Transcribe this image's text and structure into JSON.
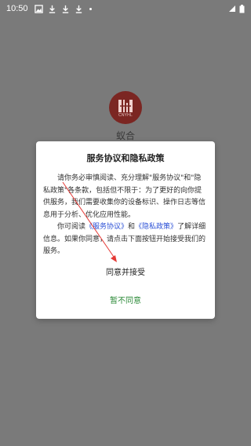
{
  "status_bar": {
    "time": "10:50",
    "icons": [
      "image-icon",
      "download-icon",
      "download-icon",
      "download-icon",
      "dot-icon"
    ],
    "right_icons": [
      "signal-icon",
      "battery-icon"
    ]
  },
  "app": {
    "name": "蚁合",
    "logo_caption": "CNYHL"
  },
  "dialog": {
    "title": "服务协议和隐私政策",
    "para1": "请你务必审慎阅读、充分理解\"服务协议\"和\"隐私政策\"各条款，包括但不限于：为了更好的向你提供服务，我们需要收集你的设备标识、操作日志等信息用于分析、优化应用性能。",
    "para2_prefix": "你可阅读",
    "link_service": "《服务协议》",
    "para2_and": "和",
    "link_privacy": "《隐私政策》",
    "para2_suffix": "了解详细信息。如果你同意，请点击下面按钮开始接受我们的服务。",
    "agree_label": "同意并接受",
    "disagree_label": "暂不同意"
  },
  "colors": {
    "overlay": "#7a7a7a",
    "link": "#2a4fd6",
    "disagree": "#2e8b3a",
    "logo": "#7b2622",
    "annotation": "#e53935"
  }
}
